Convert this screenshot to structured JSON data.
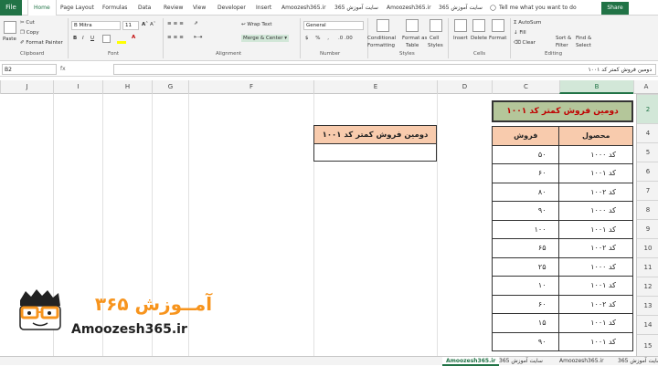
{
  "tabs": {
    "file": "File",
    "items": [
      "Home",
      "Page Layout",
      "Formulas",
      "Data",
      "Review",
      "View",
      "Developer",
      "Insert",
      "Amoozesh365.ir",
      "سایت آموزش 365",
      "Amoozesh365.ir",
      "سایت آموزش 365"
    ],
    "tell_me": "Tell me what you want to do",
    "share": "Share"
  },
  "ribbon": {
    "clipboard": {
      "paste": "Paste",
      "cut": "Cut",
      "copy": "Copy",
      "format_painter": "Format Painter",
      "group": "Clipboard"
    },
    "font": {
      "name": "B Mitra",
      "size": "11",
      "group": "Font"
    },
    "alignment": {
      "wrap": "Wrap Text",
      "merge": "Merge & Center",
      "group": "Alignment"
    },
    "number": {
      "format": "General",
      "group": "Number"
    },
    "styles": {
      "conditional": "Conditional",
      "conditional2": "Formatting",
      "format_as": "Format as",
      "format_as2": "Table",
      "cell": "Cell",
      "cell2": "Styles",
      "group": "Styles"
    },
    "cells": {
      "insert": "Insert",
      "delete": "Delete",
      "format": "Format",
      "group": "Cells"
    },
    "editing": {
      "autosum": "AutoSum",
      "fill": "Fill",
      "clear": "Clear",
      "sort": "Sort &",
      "sort2": "Filter",
      "find": "Find &",
      "find2": "Select",
      "group": "Editing"
    }
  },
  "formula_bar": {
    "name_box": "B2",
    "fx": "fx",
    "content": "دومین فروش کمتر کد ۱۰۰۱"
  },
  "columns": [
    "J",
    "I",
    "H",
    "G",
    "F",
    "E",
    "D",
    "C",
    "B",
    "A"
  ],
  "rows": [
    "2",
    "3",
    "4",
    "5",
    "6",
    "7",
    "8",
    "9",
    "10",
    "11",
    "12",
    "13",
    "14",
    "15"
  ],
  "title": "دومین فروش کمتر کد ۱۰۰۱",
  "table": {
    "headers": [
      "فروش",
      "محصول"
    ],
    "rows": [
      [
        "۵۰",
        "کد ۱۰۰۰"
      ],
      [
        "۶۰",
        "کد ۱۰۰۱"
      ],
      [
        "۸۰",
        "کد ۱۰۰۲"
      ],
      [
        "۹۰",
        "کد ۱۰۰۰"
      ],
      [
        "۱۰۰",
        "کد ۱۰۰۱"
      ],
      [
        "۶۵",
        "کد ۱۰۰۲"
      ],
      [
        "۲۵",
        "کد ۱۰۰۰"
      ],
      [
        "۱۰",
        "کد ۱۰۰۱"
      ],
      [
        "۶۰",
        "کد ۱۰۰۲"
      ],
      [
        "۱۵",
        "کد ۱۰۰۱"
      ],
      [
        "۹۰",
        "کد ۱۰۰۱"
      ]
    ]
  },
  "lookup": {
    "header": "دومین فروش کمتر کد ۱۰۰۱",
    "value": ""
  },
  "logo": {
    "text_fa": "آمــوزش ۳۶۵",
    "text_en": "Amoozesh365.ir"
  },
  "sheet_tabs": [
    "Amoozesh365.ir",
    "سایت آموزش 365",
    "Amoozesh365.ir",
    "سایت آموزش 365"
  ],
  "colors": {
    "excel_green": "#217346",
    "header_fill": "#f8cbad",
    "title_fill": "#b4c69a",
    "title_text": "#c00000",
    "logo_orange": "#f7941d"
  }
}
